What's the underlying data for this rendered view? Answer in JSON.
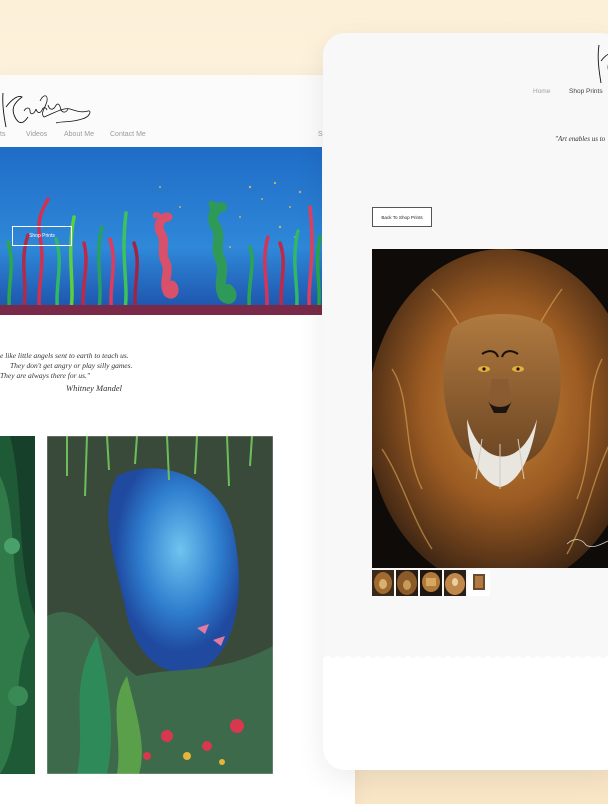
{
  "left_site": {
    "nav": {
      "item_partial": "ts",
      "videos": "Videos",
      "about": "About Me",
      "contact": "Contact Me",
      "partial_right": "S"
    },
    "hero": {
      "shop_button": "Shop Prints"
    },
    "quote": {
      "line1": "e like little angels sent to earth to teach us.",
      "line2": "They don't get angry or play silly games.",
      "line3": "They are always there for us.\"",
      "author": "Whitney Mandel"
    }
  },
  "right_site": {
    "nav": {
      "home": "Home",
      "shop": "Shop Prints"
    },
    "quote": "\"Art enables us to",
    "back_button": "Back To Shop Prints"
  }
}
